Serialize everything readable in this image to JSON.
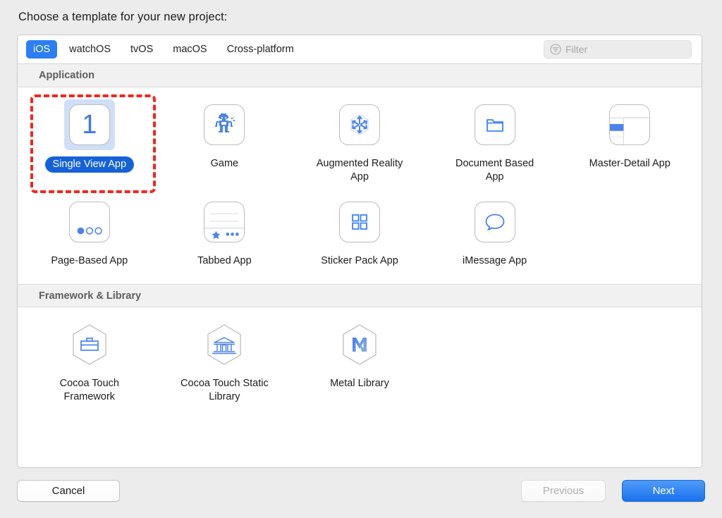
{
  "prompt": "Choose a template for your new project:",
  "tabs": [
    {
      "label": "iOS",
      "selected": true
    },
    {
      "label": "watchOS",
      "selected": false
    },
    {
      "label": "tvOS",
      "selected": false
    },
    {
      "label": "macOS",
      "selected": false
    },
    {
      "label": "Cross-platform",
      "selected": false
    }
  ],
  "filter": {
    "placeholder": "Filter",
    "value": "",
    "icon": "filter-icon"
  },
  "sections": [
    {
      "title": "Application",
      "items": [
        {
          "label": "Single View App",
          "icon": "single-view-icon",
          "selected": true
        },
        {
          "label": "Game",
          "icon": "game-robot-icon",
          "selected": false
        },
        {
          "label": "Augmented Reality App",
          "icon": "augmented-reality-cube-icon",
          "selected": false
        },
        {
          "label": "Document Based App",
          "icon": "folder-icon",
          "selected": false
        },
        {
          "label": "Master-Detail App",
          "icon": "split-view-icon",
          "selected": false
        },
        {
          "label": "Page-Based App",
          "icon": "page-dots-icon",
          "selected": false
        },
        {
          "label": "Tabbed App",
          "icon": "tab-bar-icon",
          "selected": false
        },
        {
          "label": "Sticker Pack App",
          "icon": "grid-squares-icon",
          "selected": false
        },
        {
          "label": "iMessage App",
          "icon": "speech-bubble-icon",
          "selected": false
        }
      ]
    },
    {
      "title": "Framework & Library",
      "items": [
        {
          "label": "Cocoa Touch Framework",
          "icon": "toolbox-hexagon-icon",
          "selected": false
        },
        {
          "label": "Cocoa Touch Static Library",
          "icon": "bank-building-hexagon-icon",
          "selected": false
        },
        {
          "label": "Metal Library",
          "icon": "metal-m-hexagon-icon",
          "selected": false
        }
      ]
    }
  ],
  "buttons": {
    "cancel": "Cancel",
    "previous": "Previous",
    "next": "Next"
  },
  "colors": {
    "accent_blue": "#2b7ef5",
    "selection_blue": "#1562d8",
    "selection_halo": "#cfdff7",
    "focus_ring_red": "#f3251f",
    "icon_blue": "#4a83ef",
    "dialog_bg": "#ececec"
  }
}
